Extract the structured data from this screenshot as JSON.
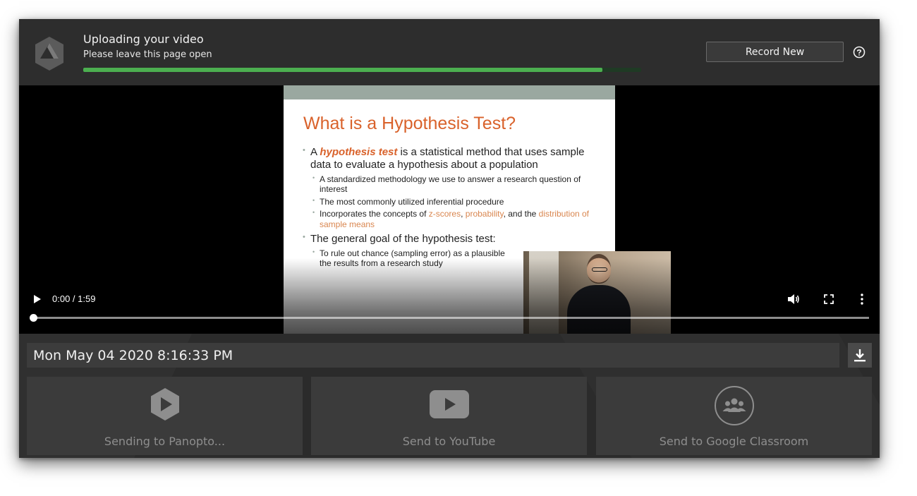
{
  "header": {
    "title": "Uploading your video",
    "subtitle": "Please leave this page open",
    "progress_fraction": 0.93,
    "record_button_label": "Record New",
    "help_icon": "help-circle-icon"
  },
  "slide": {
    "title": "What is a Hypothesis Test?",
    "bullet1_prefix": "A ",
    "bullet1_emphasis": "hypothesis test",
    "bullet1_rest": " is a statistical method that uses sample data to evaluate a hypothesis about a population",
    "sub1": "A standardized methodology we use to answer a research question of interest",
    "sub2": "The most commonly utilized inferential procedure",
    "sub3_prefix": "Incorporates the concepts of ",
    "sub3_link1": "z-scores",
    "sub3_sep": ", ",
    "sub3_link2": "probability",
    "sub3_mid": ", and the ",
    "sub3_link3": "distribution of sample means",
    "bullet2": "The general goal of the hypothesis test:",
    "sub4_line1": "To rule out chance (sampling error) as a plausible",
    "sub4_line2": "the results from a research study"
  },
  "player": {
    "time": "0:00 / 1:59",
    "position_fraction": 0.0,
    "icons": [
      "play-icon",
      "volume-icon",
      "fullscreen-icon",
      "more-vert-icon"
    ]
  },
  "recording": {
    "title_value": "Mon May 04 2020 8:16:33 PM",
    "download_icon": "download-icon"
  },
  "destinations": [
    {
      "label": "Sending to Panopto...",
      "icon": "panopto-icon"
    },
    {
      "label": "Send to YouTube",
      "icon": "youtube-icon"
    },
    {
      "label": "Send to Google Classroom",
      "icon": "google-classroom-icon"
    }
  ],
  "colors": {
    "progress": "#4caf50",
    "accent_orange": "#d9622b"
  }
}
